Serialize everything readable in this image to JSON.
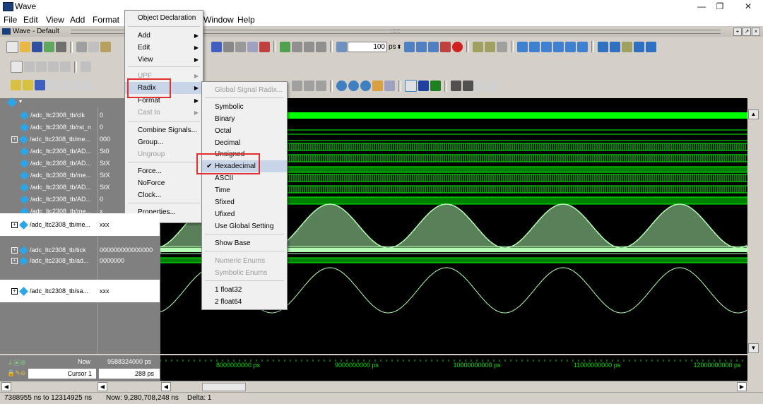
{
  "window": {
    "title": "Wave",
    "min": "—",
    "max": "❐",
    "close": "✕"
  },
  "menubar": [
    {
      "label": "File"
    },
    {
      "label": "Edit"
    },
    {
      "label": "View"
    },
    {
      "label": "Add"
    },
    {
      "label": "Format"
    },
    {
      "label": "Window"
    },
    {
      "label": "Help"
    }
  ],
  "subwindow": {
    "title": "Wave - Default",
    "grip": "::::::"
  },
  "toolbar": {
    "time_value": "100",
    "time_unit": "ps"
  },
  "signals": [
    {
      "name": "/adc_ltc2308_tb/clk",
      "value": "0",
      "expandable": false
    },
    {
      "name": "/adc_ltc2308_tb/rst_n",
      "value": "0",
      "expandable": false
    },
    {
      "name": "/adc_ltc2308_tb/me...",
      "value": "000",
      "expandable": true
    },
    {
      "name": "/adc_ltc2308_tb/AD...",
      "value": "St0",
      "expandable": false
    },
    {
      "name": "/adc_ltc2308_tb/AD...",
      "value": "StX",
      "expandable": false
    },
    {
      "name": "/adc_ltc2308_tb/me...",
      "value": "StX",
      "expandable": false
    },
    {
      "name": "/adc_ltc2308_tb/AD...",
      "value": "StX",
      "expandable": false
    },
    {
      "name": "/adc_ltc2308_tb/AD...",
      "value": "0",
      "expandable": false
    },
    {
      "name": "/adc_ltc2308_tb/me...",
      "value": "x",
      "expandable": false
    }
  ],
  "selected_signal_1": {
    "name": "/adc_ltc2308_tb/me...",
    "value": "xxx"
  },
  "signals_mid": [
    {
      "name": "/adc_ltc2308_tb/tick",
      "value": "000000000000000"
    },
    {
      "name": "/adc_ltc2308_tb/ad...",
      "value": "0000000"
    }
  ],
  "selected_signal_2": {
    "name": "/adc_ltc2308_tb/sa...",
    "value": "xxx"
  },
  "cursor": {
    "now_label": "Now",
    "now_value": "9588324000 ps",
    "cursor_label": "Cursor 1",
    "cursor_value": "288 ps"
  },
  "timeline": [
    "8000000000 ps",
    "9000000000 ps",
    "10000000000 ps",
    "11000000000 ps",
    "12000000000 ps"
  ],
  "status": {
    "range": "7388955 ns to 12314925 ns",
    "now": "Now: 9,280,708,248 ns",
    "delta": "Delta: 1"
  },
  "context_menu": {
    "header": "Object Declaration",
    "items": [
      {
        "label": "Add",
        "sub": true,
        "disabled": false
      },
      {
        "label": "Edit",
        "sub": true,
        "disabled": false
      },
      {
        "label": "View",
        "sub": true,
        "disabled": false
      },
      {
        "label": "UPF",
        "sub": true,
        "disabled": true
      },
      {
        "label": "Radix",
        "sub": true,
        "disabled": false
      },
      {
        "label": "Format",
        "sub": true,
        "disabled": false
      },
      {
        "label": "Cast to",
        "sub": true,
        "disabled": true
      },
      {
        "label": "Combine Signals...",
        "sub": false,
        "disabled": false
      },
      {
        "label": "Group...",
        "sub": false,
        "disabled": false
      },
      {
        "label": "Ungroup",
        "sub": false,
        "disabled": true
      },
      {
        "label": "Force...",
        "sub": false,
        "disabled": false
      },
      {
        "label": "NoForce",
        "sub": false,
        "disabled": false
      },
      {
        "label": "Clock...",
        "sub": false,
        "disabled": false
      },
      {
        "label": "Properties...",
        "sub": false,
        "disabled": false
      }
    ]
  },
  "radix_menu": {
    "items": [
      {
        "label": "Global Signal Radix...",
        "disabled": true
      },
      {
        "label": "Symbolic",
        "disabled": false
      },
      {
        "label": "Binary",
        "disabled": false
      },
      {
        "label": "Octal",
        "disabled": false
      },
      {
        "label": "Decimal",
        "disabled": false
      },
      {
        "label": "Unsigned",
        "disabled": false
      },
      {
        "label": "Hexadecimal",
        "disabled": false,
        "checked": true
      },
      {
        "label": "ASCII",
        "disabled": false
      },
      {
        "label": "Time",
        "disabled": false
      },
      {
        "label": "Sfixed",
        "disabled": false
      },
      {
        "label": "Ufixed",
        "disabled": false
      },
      {
        "label": "Use Global Setting",
        "disabled": false
      },
      {
        "label": "Show Base",
        "disabled": false
      },
      {
        "label": "Numeric Enums",
        "disabled": true
      },
      {
        "label": "Symbolic Enums",
        "disabled": true
      },
      {
        "label": "1 float32",
        "disabled": false
      },
      {
        "label": "2 float64",
        "disabled": false
      }
    ]
  },
  "colors": {
    "wave": "#00ff00",
    "analog": "#b4ffb4",
    "highlight": "#e03030",
    "signal_icon": "#2aa6e8"
  }
}
